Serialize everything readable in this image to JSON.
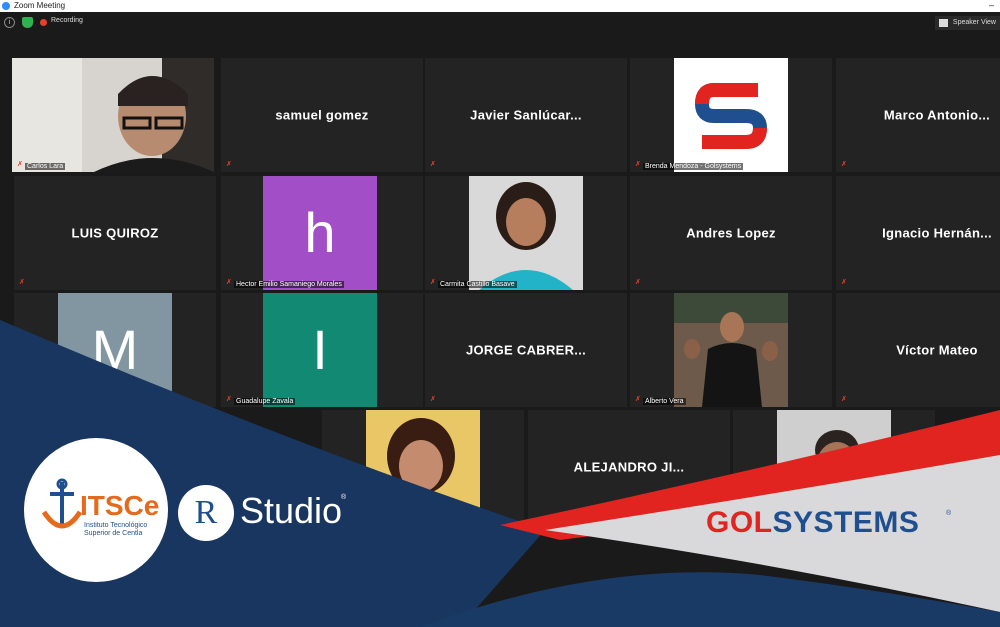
{
  "window": {
    "title": "Zoom Meeting"
  },
  "toolbar": {
    "recording_label": "Recording",
    "view_label": "Speaker View"
  },
  "tiles": {
    "t00": {
      "label": "Carlos Lara"
    },
    "t01": {
      "name": "samuel gomez"
    },
    "t02": {
      "name": "Javier  Sanlúcar..."
    },
    "t03": {
      "label": "Brenda Mendoza - Golsystems"
    },
    "t04": {
      "name": "Marco  Antonio..."
    },
    "t10": {
      "name": "LUIS QUIROZ"
    },
    "t11": {
      "avatar": "h",
      "label": "Hector Emilio Samaniego Morales"
    },
    "t12": {
      "label": "Carmita Castillo Basave"
    },
    "t13": {
      "name": "Andres Lopez"
    },
    "t14": {
      "name": "Ignacio  Hernán..."
    },
    "t20": {
      "avatar": "M"
    },
    "t21": {
      "avatar": "I",
      "label": "Guadalupe Zavala"
    },
    "t22": {
      "name": "JORGE  CABRER..."
    },
    "t23": {
      "label": "Alberto Vera"
    },
    "t24": {
      "name": "Víctor Mateo"
    },
    "t32": {
      "name": "ALEJANDRO  JI..."
    }
  },
  "logos": {
    "itsce": {
      "name": "ITSCe",
      "subtitle_1": "Instituto Tecnológico",
      "subtitle_2": "Superior de Centla"
    },
    "rstudio": {
      "mark": "R",
      "name": "Studio",
      "reg": "®"
    },
    "golsystems": {
      "part1": "GOL",
      "part2": "S",
      "part3": "YSTEMS",
      "reg": "®"
    }
  },
  "colors": {
    "active_border": "#d3e45a",
    "mic_muted": "#e8402b",
    "brand_blue": "#1f4f8f",
    "brand_red": "#e1241f",
    "itsce_orange": "#e56a1c",
    "avatar_h": "#a24fc7",
    "avatar_i": "#128a73",
    "avatar_m": "#8296a1"
  }
}
